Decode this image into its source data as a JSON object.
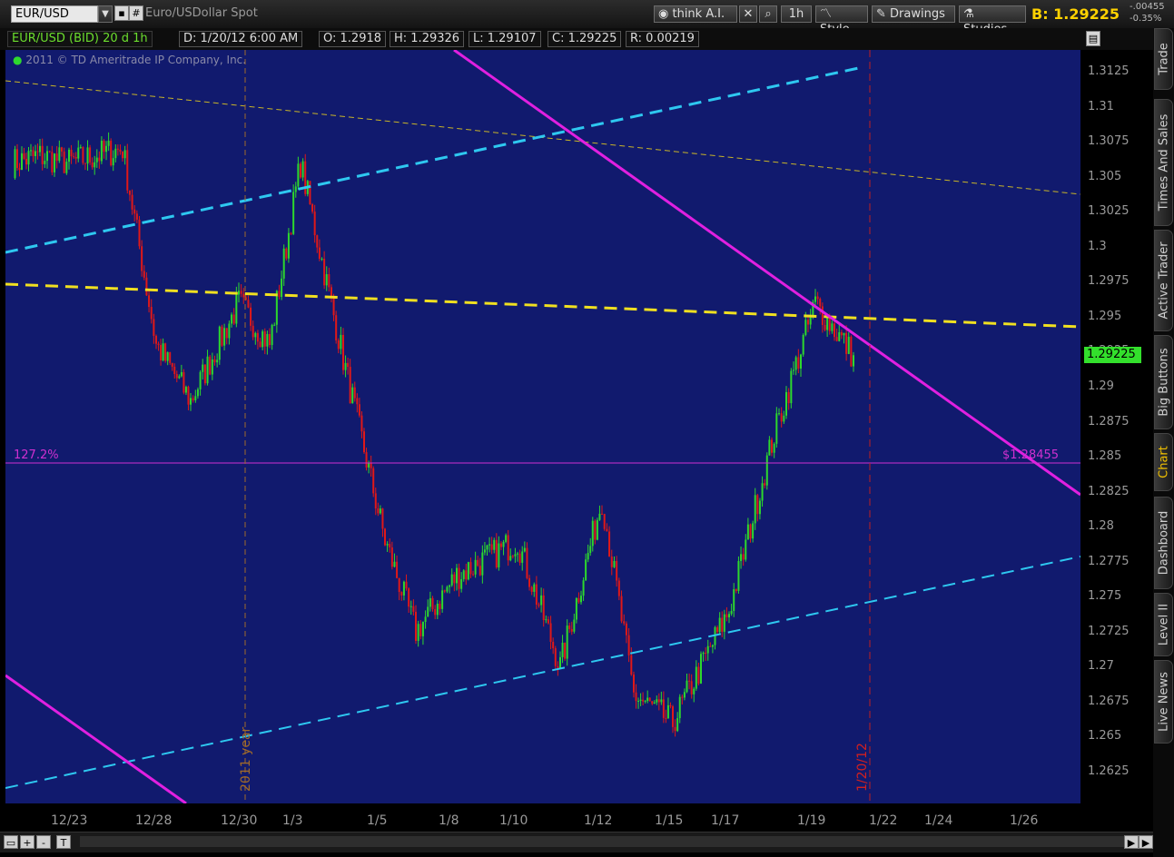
{
  "toolbar": {
    "symbol": "EUR/USD",
    "description": "Euro/USDollar Spot",
    "think_label": "think A.I.",
    "aggregation": "1h",
    "style_label": "Style",
    "drawings_label": "Drawings",
    "studies_label": "Studies",
    "bid_prefix": "B:",
    "bid_price": "1.29225",
    "net_change": "-.00455",
    "pct_change": "-0.35%"
  },
  "infobar": {
    "title": "EUR/USD (BID) 20 d 1h",
    "date": "D: 1/20/12 6:00 AM",
    "open": "O: 1.2918",
    "high": "H: 1.29326",
    "low": "L: 1.29107",
    "close": "C: 1.29225",
    "range": "R: 0.00219"
  },
  "copyright": "2011 © TD Ameritrade IP Company, Inc.",
  "annotations": {
    "fib_label": "127.2%",
    "fib_price": "$1.28455",
    "year_marker": "2011 year",
    "date_marker": "1/20/12"
  },
  "last_price_label": "1.29225",
  "right_tabs": [
    "Trade",
    "Times And Sales",
    "Active Trader",
    "Big Buttons",
    "Chart",
    "Dashboard",
    "Level II",
    "Live News"
  ],
  "bottom_buttons": [
    "+",
    "-",
    "T"
  ],
  "colors": {
    "background": "#111a6e",
    "up_candle": "#2dd82d",
    "down_candle": "#e01818",
    "trend_cyan": "#2ec8f0",
    "trend_yellow": "#f0e020",
    "trend_magenta": "#e020e0",
    "fib_line": "#d030d0"
  },
  "chart_data": {
    "type": "candlestick",
    "symbol": "EUR/USD",
    "interval": "1h",
    "y_range": [
      1.26,
      1.3145
    ],
    "price_ticks": [
      "1.3125",
      "1.31",
      "1.3075",
      "1.305",
      "1.3025",
      "1.3",
      "1.2975",
      "1.295",
      "1.2925",
      "1.29",
      "1.2875",
      "1.285",
      "1.2825",
      "1.28",
      "1.2775",
      "1.275",
      "1.2725",
      "1.27",
      "1.2675",
      "1.265",
      "1.2625"
    ],
    "time_ticks": [
      "12/23",
      "12/28",
      "12/30",
      "1/3",
      "1/5",
      "1/8",
      "1/10",
      "1/12",
      "1/15",
      "1/17",
      "1/19",
      "1/22",
      "1/24",
      "1/26"
    ],
    "last": {
      "open": 1.2918,
      "high": 1.29326,
      "low": 1.29107,
      "close": 1.29225
    },
    "fib_level": {
      "label": "127.2%",
      "price": 1.28455
    },
    "approx_closes": [
      {
        "x": "12/21",
        "price": 1.306
      },
      {
        "x": "12/22",
        "price": 1.3065
      },
      {
        "x": "12/23",
        "price": 1.306
      },
      {
        "x": "12/27",
        "price": 1.307
      },
      {
        "x": "12/28",
        "price": 1.293
      },
      {
        "x": "12/29",
        "price": 1.289
      },
      {
        "x": "12/30",
        "price": 1.296
      },
      {
        "x": "1/2",
        "price": 1.293
      },
      {
        "x": "1/3",
        "price": 1.306
      },
      {
        "x": "1/4",
        "price": 1.292
      },
      {
        "x": "1/5",
        "price": 1.279
      },
      {
        "x": "1/6",
        "price": 1.2725
      },
      {
        "x": "1/9",
        "price": 1.2765
      },
      {
        "x": "1/10",
        "price": 1.279
      },
      {
        "x": "1/11",
        "price": 1.27
      },
      {
        "x": "1/12",
        "price": 1.282
      },
      {
        "x": "1/13",
        "price": 1.268
      },
      {
        "x": "1/16",
        "price": 1.266
      },
      {
        "x": "1/17",
        "price": 1.274
      },
      {
        "x": "1/18",
        "price": 1.286
      },
      {
        "x": "1/19",
        "price": 1.296
      },
      {
        "x": "1/20",
        "price": 1.2922
      }
    ]
  }
}
